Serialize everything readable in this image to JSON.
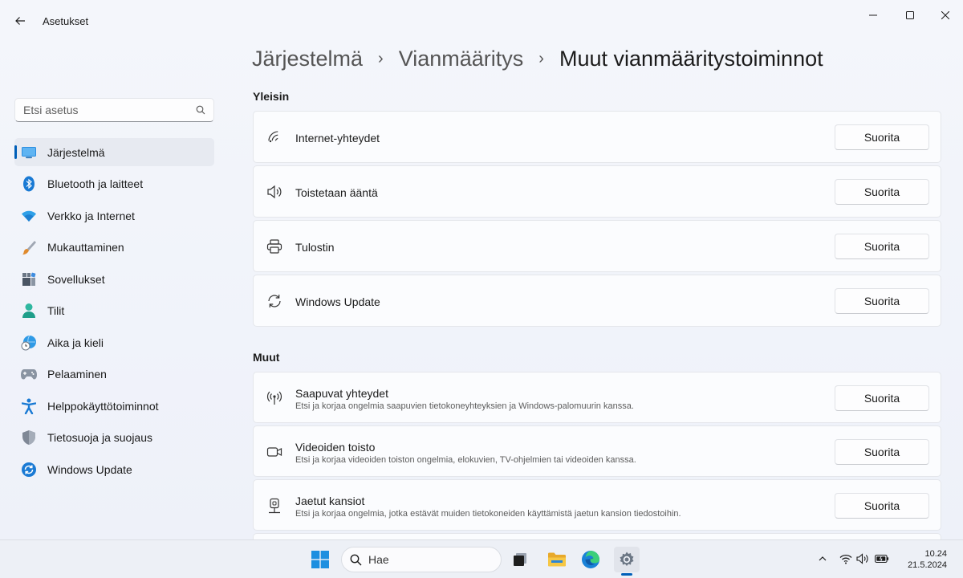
{
  "window": {
    "title": "Asetukset"
  },
  "sidebar": {
    "search_placeholder": "Etsi asetus",
    "items": [
      {
        "label": "Järjestelmä",
        "icon": "monitor-icon",
        "active": true
      },
      {
        "label": "Bluetooth ja laitteet",
        "icon": "bluetooth-icon"
      },
      {
        "label": "Verkko ja Internet",
        "icon": "wifi-icon"
      },
      {
        "label": "Mukauttaminen",
        "icon": "brush-icon"
      },
      {
        "label": "Sovellukset",
        "icon": "apps-icon"
      },
      {
        "label": "Tilit",
        "icon": "person-icon"
      },
      {
        "label": "Aika ja kieli",
        "icon": "globe-clock-icon"
      },
      {
        "label": "Pelaaminen",
        "icon": "gamepad-icon"
      },
      {
        "label": "Helppokäyttötoiminnot",
        "icon": "accessibility-icon"
      },
      {
        "label": "Tietosuoja ja suojaus",
        "icon": "shield-icon"
      },
      {
        "label": "Windows Update",
        "icon": "update-icon"
      }
    ]
  },
  "breadcrumb": {
    "part1": "Järjestelmä",
    "part2": "Vianmääritys",
    "current": "Muut vianmääritystoiminnot"
  },
  "sections": {
    "common_label": "Yleisin",
    "other_label": "Muut"
  },
  "common": [
    {
      "title": "Internet-yhteydet",
      "icon": "wifi-signal-icon",
      "button": "Suorita"
    },
    {
      "title": "Toistetaan ääntä",
      "icon": "speaker-icon",
      "button": "Suorita"
    },
    {
      "title": "Tulostin",
      "icon": "printer-icon",
      "button": "Suorita"
    },
    {
      "title": "Windows Update",
      "icon": "refresh-icon",
      "button": "Suorita"
    }
  ],
  "other": [
    {
      "title": "Saapuvat yhteydet",
      "desc": "Etsi ja korjaa ongelmia saapuvien tietokoneyhteyksien ja Windows-palomuurin kanssa.",
      "icon": "antenna-icon",
      "button": "Suorita"
    },
    {
      "title": "Videoiden toisto",
      "desc": "Etsi ja korjaa videoiden toiston ongelmia, elokuvien, TV-ohjelmien tai videoiden kanssa.",
      "icon": "video-camera-icon",
      "button": "Suorita"
    },
    {
      "title": "Jaetut kansiot",
      "desc": "Etsi ja korjaa ongelmia, jotka estävät muiden tietokoneiden käyttämistä jaetun kansion tiedostoihin.",
      "icon": "shared-folder-icon",
      "button": "Suorita"
    }
  ],
  "taskbar": {
    "search_placeholder": "Hae",
    "time": "10.24",
    "date": "21.5.2024"
  },
  "colors": {
    "accent": "#005fb8"
  }
}
